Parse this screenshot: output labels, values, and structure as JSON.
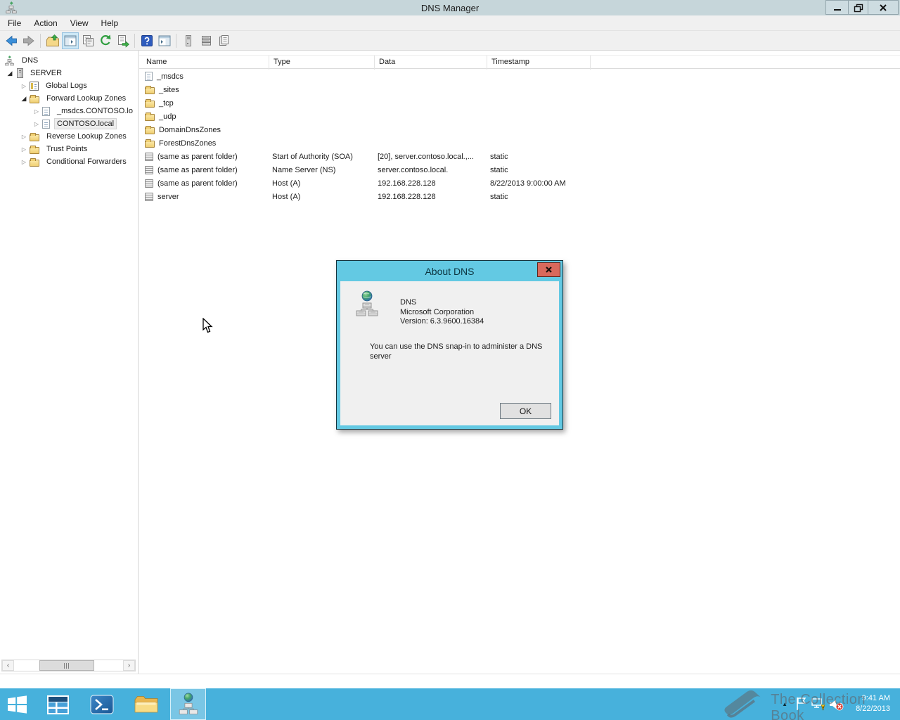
{
  "window": {
    "title": "DNS Manager"
  },
  "menu": {
    "items": [
      "File",
      "Action",
      "View",
      "Help"
    ]
  },
  "toolbar": {
    "buttons": [
      "back",
      "forward",
      "up-one-level",
      "show-hide-console-tree",
      "properties",
      "refresh",
      "export-list",
      "help",
      "show-hide-action-pane",
      "servers",
      "record-list",
      "properties-page"
    ]
  },
  "tree": {
    "items": [
      {
        "label": "DNS",
        "icon": "dns-console-icon",
        "state": "root",
        "selected": false
      },
      {
        "label": "SERVER",
        "icon": "server-icon",
        "state": "expanded",
        "selected": false
      },
      {
        "label": "Global Logs",
        "icon": "log-icon",
        "state": "collapsed",
        "selected": false
      },
      {
        "label": "Forward Lookup Zones",
        "icon": "folder-icon",
        "state": "expanded",
        "selected": false
      },
      {
        "label": "_msdcs.CONTOSO.lo",
        "icon": "zone-icon",
        "state": "collapsed",
        "selected": false
      },
      {
        "label": "CONTOSO.local",
        "icon": "zone-icon",
        "state": "collapsed",
        "selected": true
      },
      {
        "label": "Reverse Lookup Zones",
        "icon": "folder-icon",
        "state": "collapsed",
        "selected": false
      },
      {
        "label": "Trust Points",
        "icon": "folder-icon",
        "state": "collapsed",
        "selected": false
      },
      {
        "label": "Conditional Forwarders",
        "icon": "folder-icon",
        "state": "collapsed",
        "selected": false
      }
    ]
  },
  "list": {
    "columns": [
      "Name",
      "Type",
      "Data",
      "Timestamp"
    ],
    "rows": [
      {
        "icon": "zone-icon",
        "name": "_msdcs",
        "type": "",
        "data": "",
        "timestamp": ""
      },
      {
        "icon": "folder-icon",
        "name": "_sites",
        "type": "",
        "data": "",
        "timestamp": ""
      },
      {
        "icon": "folder-icon",
        "name": "_tcp",
        "type": "",
        "data": "",
        "timestamp": ""
      },
      {
        "icon": "folder-icon",
        "name": "_udp",
        "type": "",
        "data": "",
        "timestamp": ""
      },
      {
        "icon": "folder-icon",
        "name": "DomainDnsZones",
        "type": "",
        "data": "",
        "timestamp": ""
      },
      {
        "icon": "folder-icon",
        "name": "ForestDnsZones",
        "type": "",
        "data": "",
        "timestamp": ""
      },
      {
        "icon": "record-icon",
        "name": "(same as parent folder)",
        "type": "Start of Authority (SOA)",
        "data": "[20], server.contoso.local.,...",
        "timestamp": "static"
      },
      {
        "icon": "record-icon",
        "name": "(same as parent folder)",
        "type": "Name Server (NS)",
        "data": "server.contoso.local.",
        "timestamp": "static"
      },
      {
        "icon": "record-icon",
        "name": "(same as parent folder)",
        "type": "Host (A)",
        "data": "192.168.228.128",
        "timestamp": "8/22/2013 9:00:00 AM"
      },
      {
        "icon": "record-icon",
        "name": "server",
        "type": "Host (A)",
        "data": "192.168.228.128",
        "timestamp": "static"
      }
    ]
  },
  "dialog": {
    "title": "About DNS",
    "product_name": "DNS",
    "company": "Microsoft Corporation",
    "version": "Version: 6.3.9600.16384",
    "description": "You can use the DNS snap-in to administer a DNS server",
    "ok_label": "OK"
  },
  "taskbar": {
    "items": [
      "start",
      "server-manager",
      "powershell",
      "file-explorer",
      "dns-manager"
    ],
    "active_item": "dns-manager",
    "tray": {
      "icons": [
        "hidden-icons-arrow",
        "action-center-flag",
        "network-warning",
        "volume-muted"
      ],
      "time": "9:41 AM",
      "date": "8/22/2013"
    }
  },
  "watermark": {
    "text": "The Collection Book"
  },
  "colors": {
    "taskbar": "#47b1dc",
    "dialog_accent": "#63c9e3",
    "dialog_close": "#d9695c",
    "titlebar": "#c6d6da",
    "chrome": "#f0f0f0"
  }
}
